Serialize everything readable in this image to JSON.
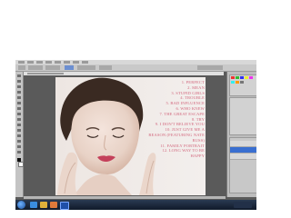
{
  "app": {
    "name": "Photoshop",
    "menu_count": 12
  },
  "document": {
    "tracklist": [
      "1. PERFECT",
      "2. MEAN",
      "3. STUPID GIRLS",
      "4. TROUBLE",
      "5. BAD INFLUENCE",
      "6. WHO KNEW",
      "7. THE GREAT ESCAPE",
      "8. TRY",
      "9. I DON'T BELIEVE YOU",
      "10. JUST GIVE ME A",
      "REASON (FEATURING NATE",
      "RUSS)",
      "11. FAMILY PORTRAIT",
      "12. LONG WAY TO BE",
      "HAPPY"
    ]
  },
  "colors": {
    "text_pink": "#d2687e",
    "lips": "#c4405a",
    "taskbar": "#1c2a40",
    "active_layer": "#3a6fd0"
  },
  "icons": {
    "start": "windows-start-icon",
    "taskbar_apps": [
      "ie-icon",
      "folder-icon",
      "media-player-icon",
      "photoshop-icon"
    ]
  }
}
